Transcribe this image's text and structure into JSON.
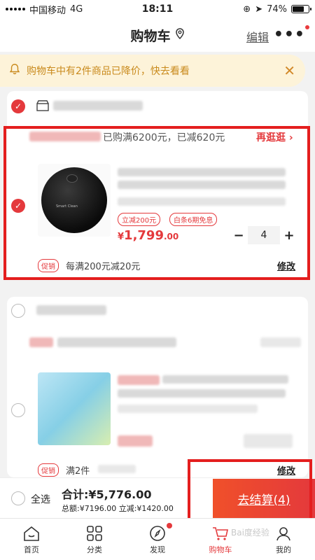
{
  "status_bar": {
    "carrier": "中国移动",
    "network": "4G",
    "time": "18:11",
    "battery": "74%",
    "battery_level": 0.74
  },
  "header": {
    "title": "购物车",
    "edit_label": "编辑",
    "more_label": "•••"
  },
  "notice": {
    "text": "购物车中有2件商品已降价，快去看看",
    "close": "✕"
  },
  "store1": {
    "promo_text": "已购满6200元，已减620元",
    "go_more": "再逛逛 ›",
    "product": {
      "tags": [
        "立减200元",
        "白条6期免息"
      ],
      "price_symbol": "¥",
      "price_int": "1,799",
      "price_dec": ".00",
      "qty": "4",
      "minus": "−",
      "plus": "+",
      "image_brand": "Smart Clean"
    },
    "promo_badge": "促销",
    "promo_desc": "每满200元减20元",
    "modify": "修改"
  },
  "store2": {
    "promo_badge": "促销",
    "promo_desc": "满2件",
    "modify": "修改"
  },
  "checkout": {
    "select_all": "全选",
    "total": "合计:¥5,776.00",
    "subtotal": "总额:¥7196.00 立减:¥1420.00",
    "button": "去结算(4)"
  },
  "tabs": [
    {
      "label": "首页"
    },
    {
      "label": "分类"
    },
    {
      "label": "发现"
    },
    {
      "label": "购物车"
    },
    {
      "label": "我的"
    }
  ],
  "watermark": "Bai度经验",
  "colors": {
    "accent": "#e4393c",
    "notice_bg": "#fdf3d9",
    "notice_text": "#c98a1c",
    "highlight_box": "#e41e1e"
  }
}
